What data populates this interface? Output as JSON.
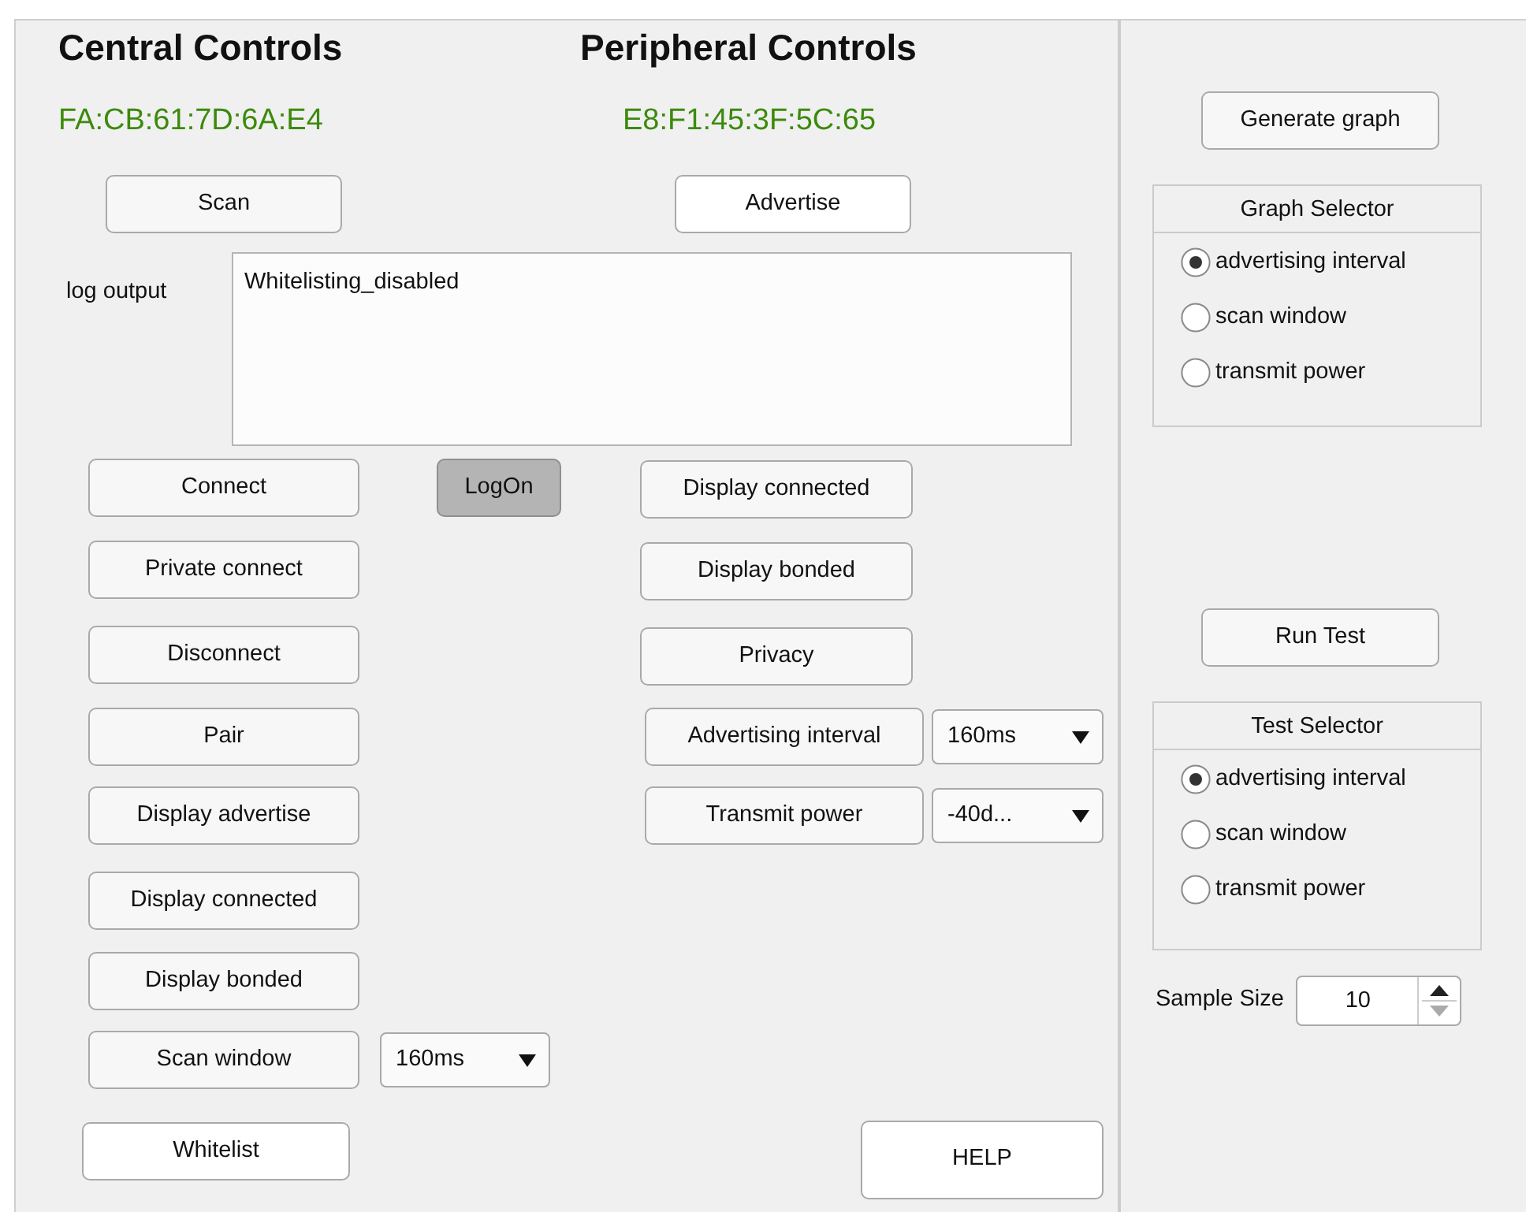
{
  "central": {
    "title": "Central Controls",
    "address": "FA:CB:61:7D:6A:E4",
    "scan_button": "Scan",
    "log_label": "log output",
    "log_text": "Whitelisting_disabled",
    "buttons": [
      "Connect",
      "Private connect",
      "Disconnect",
      "Pair",
      "Display advertise",
      "Display connected",
      "Display bonded",
      "Scan window"
    ],
    "logon_button": {
      "label": "LogOn",
      "pressed": true
    },
    "scan_window_select": {
      "value": "160ms"
    },
    "whitelist_button": "Whitelist"
  },
  "peripheral": {
    "title": "Peripheral Controls",
    "address": "E8:F1:45:3F:5C:65",
    "advertise_button": "Advertise",
    "buttons": [
      "Display connected",
      "Display bonded",
      "Privacy"
    ],
    "settings": [
      {
        "label": "Advertising interval",
        "value": "160ms"
      },
      {
        "label": "Transmit power",
        "value": "-40d..."
      }
    ],
    "help_button": "HELP"
  },
  "graph": {
    "button": "Generate graph",
    "title": "Graph Selector",
    "options": [
      {
        "label": "advertising interval",
        "selected": true
      },
      {
        "label": "scan window",
        "selected": false
      },
      {
        "label": "transmit power",
        "selected": false
      }
    ]
  },
  "test": {
    "button": "Run Test",
    "title": "Test Selector",
    "options": [
      {
        "label": "advertising interval",
        "selected": true
      },
      {
        "label": "scan window",
        "selected": false
      },
      {
        "label": "transmit power",
        "selected": false
      }
    ]
  },
  "sample_size": {
    "label": "Sample Size",
    "value": "10"
  }
}
